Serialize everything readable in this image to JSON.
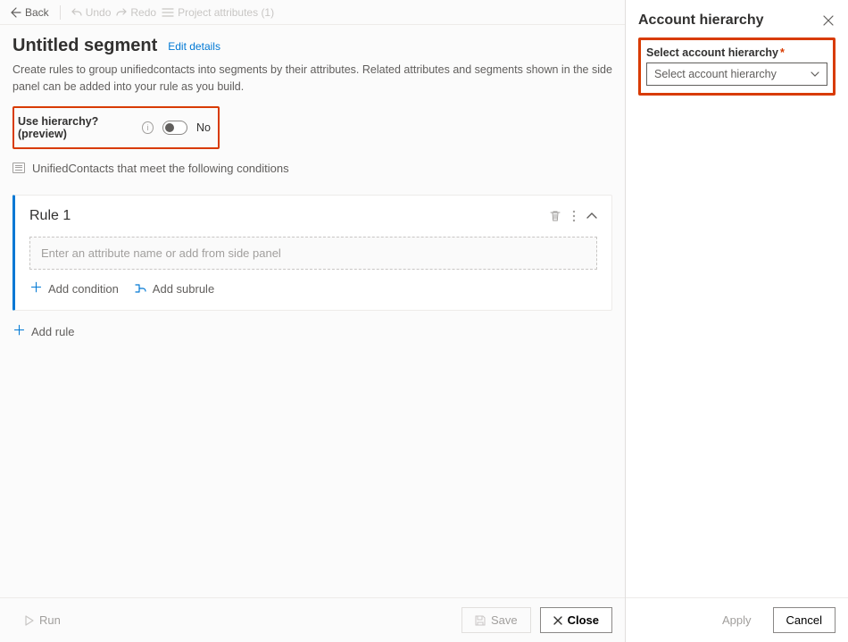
{
  "toolbar": {
    "back": "Back",
    "undo": "Undo",
    "redo": "Redo",
    "project_attributes": "Project attributes (1)"
  },
  "header": {
    "title": "Untitled segment",
    "edit_link": "Edit details"
  },
  "description": "Create rules to group unifiedcontacts into segments by their attributes. Related attributes and segments shown in the side panel can be added into your rule as you build.",
  "hierarchy_toggle": {
    "label": "Use hierarchy? (preview)",
    "value_text": "No"
  },
  "conditions_intro": "UnifiedContacts that meet the following conditions",
  "rule": {
    "title": "Rule 1",
    "input_placeholder": "Enter an attribute name or add from side panel",
    "add_condition": "Add condition",
    "add_subrule": "Add subrule"
  },
  "add_rule": "Add rule",
  "footer": {
    "run": "Run",
    "save": "Save",
    "close": "Close"
  },
  "panel": {
    "title": "Account hierarchy",
    "field_label": "Select account hierarchy",
    "select_placeholder": "Select account hierarchy",
    "apply": "Apply",
    "cancel": "Cancel"
  }
}
